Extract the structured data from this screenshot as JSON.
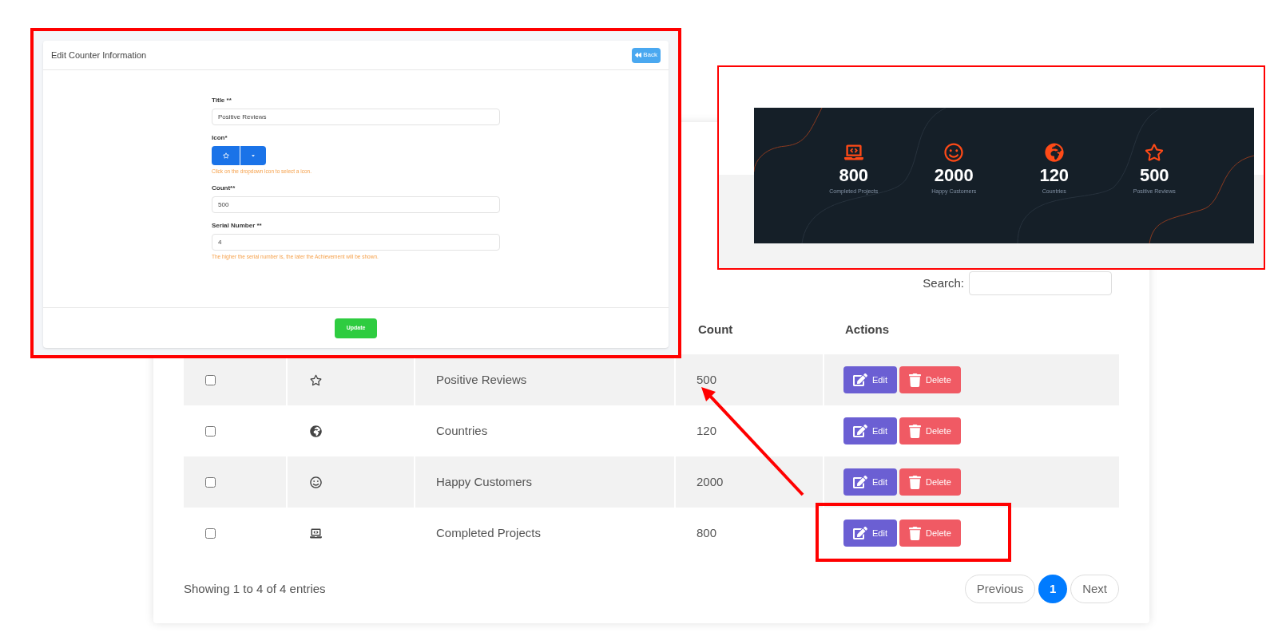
{
  "edit_form": {
    "title": "Edit Counter Information",
    "back_button": "Back",
    "fields": [
      {
        "kind": "text",
        "label": "Title **",
        "value": "Positive Reviews"
      },
      {
        "kind": "icon_picker",
        "label": "Icon*",
        "hint": "Click on the dropdown icon to select a icon."
      },
      {
        "kind": "text",
        "label": "Count**",
        "value": "500"
      },
      {
        "kind": "text",
        "label": "Serial Number **",
        "value": "4",
        "hint": "The higher the serial number is, the later the Achievement will be shown."
      }
    ],
    "submit_button": "Update"
  },
  "counter_preview": {
    "stats": [
      {
        "kind": "laptop",
        "value": "800",
        "label": "Completed Projects"
      },
      {
        "kind": "smile",
        "value": "2000",
        "label": "Happy Customers"
      },
      {
        "kind": "globe",
        "value": "120",
        "label": "Countries"
      },
      {
        "kind": "star",
        "value": "500",
        "label": "Positive Reviews"
      }
    ]
  },
  "table": {
    "search_label": "Search:",
    "columns": [
      "Count",
      "Actions"
    ],
    "rows": [
      {
        "checked": false,
        "kind": "star",
        "title": "Positive Reviews",
        "count": "500",
        "actions": [
          "Edit",
          "Delete"
        ]
      },
      {
        "checked": false,
        "kind": "globe",
        "title": "Countries",
        "count": "120",
        "actions": [
          "Edit",
          "Delete"
        ]
      },
      {
        "checked": false,
        "kind": "smile",
        "title": "Happy Customers",
        "count": "2000",
        "actions": [
          "Edit",
          "Delete"
        ]
      },
      {
        "checked": false,
        "kind": "laptop",
        "title": "Completed Projects",
        "count": "800",
        "actions": [
          "Edit",
          "Delete"
        ]
      }
    ],
    "info": "Showing 1 to 4 of 4 entries",
    "pagination": [
      {
        "label": "Previous",
        "selected": false
      },
      {
        "label": "1",
        "selected": true
      },
      {
        "label": "Next",
        "selected": false
      }
    ]
  }
}
